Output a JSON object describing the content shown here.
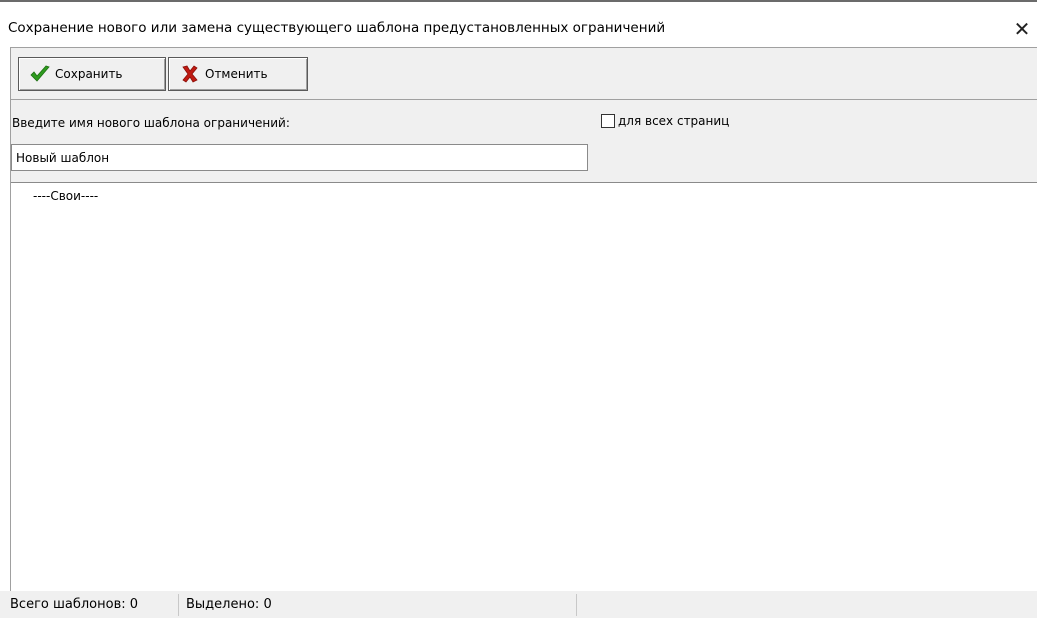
{
  "window": {
    "title": "Сохранение нового или замена существующего шаблона предустановленных ограничений",
    "close_glyph": "✕"
  },
  "toolbar": {
    "save_label": "Сохранить",
    "save_icon": "checkmark-icon",
    "cancel_label": "Отменить",
    "cancel_icon": "cross-icon",
    "save_icon_color": "#2e9b1e",
    "cancel_icon_color": "#c01a12"
  },
  "form": {
    "name_label": "Введите имя нового шаблона ограничений:",
    "name_value": "Новый шаблон",
    "all_pages_label": "для всех страниц",
    "all_pages_checked": false
  },
  "list": {
    "groups": [
      {
        "label": "----Свои----"
      }
    ]
  },
  "status": {
    "total": "Всего шаблонов: 0",
    "selected": "Выделено: 0"
  }
}
